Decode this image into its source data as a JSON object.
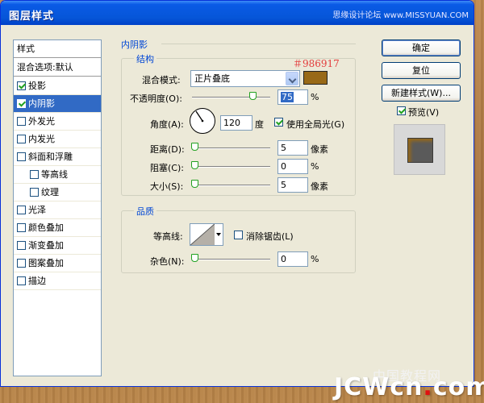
{
  "window": {
    "title": "图层样式",
    "watermark_top": "思缘设计论坛 www.MISSYUAN.COM"
  },
  "sidebar": {
    "header": "样式",
    "blend_options": "混合选项:默认",
    "items": [
      {
        "label": "投影",
        "checked": true,
        "indent": false
      },
      {
        "label": "内阴影",
        "checked": true,
        "indent": false,
        "selected": true
      },
      {
        "label": "外发光",
        "checked": false,
        "indent": false
      },
      {
        "label": "内发光",
        "checked": false,
        "indent": false
      },
      {
        "label": "斜面和浮雕",
        "checked": false,
        "indent": false
      },
      {
        "label": "等高线",
        "checked": false,
        "indent": true
      },
      {
        "label": "纹理",
        "checked": false,
        "indent": true
      },
      {
        "label": "光泽",
        "checked": false,
        "indent": false
      },
      {
        "label": "颜色叠加",
        "checked": false,
        "indent": false
      },
      {
        "label": "渐变叠加",
        "checked": false,
        "indent": false
      },
      {
        "label": "图案叠加",
        "checked": false,
        "indent": false
      },
      {
        "label": "描边",
        "checked": false,
        "indent": false
      }
    ]
  },
  "inner_shadow": {
    "section_title": "内阴影",
    "structure_title": "结构",
    "blend_mode_label": "混合模式:",
    "blend_mode_value": "正片叠底",
    "color_hex_note": "＃986917",
    "color": "#986917",
    "opacity_label": "不透明度(O):",
    "opacity_value": "75",
    "opacity_unit": "%",
    "angle_label": "角度(A):",
    "angle_value": "120",
    "angle_unit": "度",
    "global_light_label": "使用全局光(G)",
    "global_light_checked": true,
    "distance_label": "距离(D):",
    "distance_value": "5",
    "distance_unit": "像素",
    "choke_label": "阻塞(C):",
    "choke_value": "0",
    "choke_unit": "%",
    "size_label": "大小(S):",
    "size_value": "5",
    "size_unit": "像素",
    "quality_title": "品质",
    "contour_label": "等高线:",
    "antialias_label": "消除锯齿(L)",
    "antialias_checked": false,
    "noise_label": "杂色(N):",
    "noise_value": "0",
    "noise_unit": "%"
  },
  "buttons": {
    "ok": "确定",
    "reset": "复位",
    "new_style": "新建样式(W)...",
    "preview_label": "预览(V)",
    "preview_checked": true
  },
  "watermark_bottom": {
    "cn": "中国教程网",
    "logo_main": "JCWcn",
    "logo_dot": ".",
    "logo_tail": "com"
  },
  "icons": [
    "checkbox-checked-icon",
    "checkbox-icon",
    "dropdown-arrow-icon",
    "angle-dial-icon",
    "slider-thumb-icon",
    "contour-preview-icon"
  ]
}
